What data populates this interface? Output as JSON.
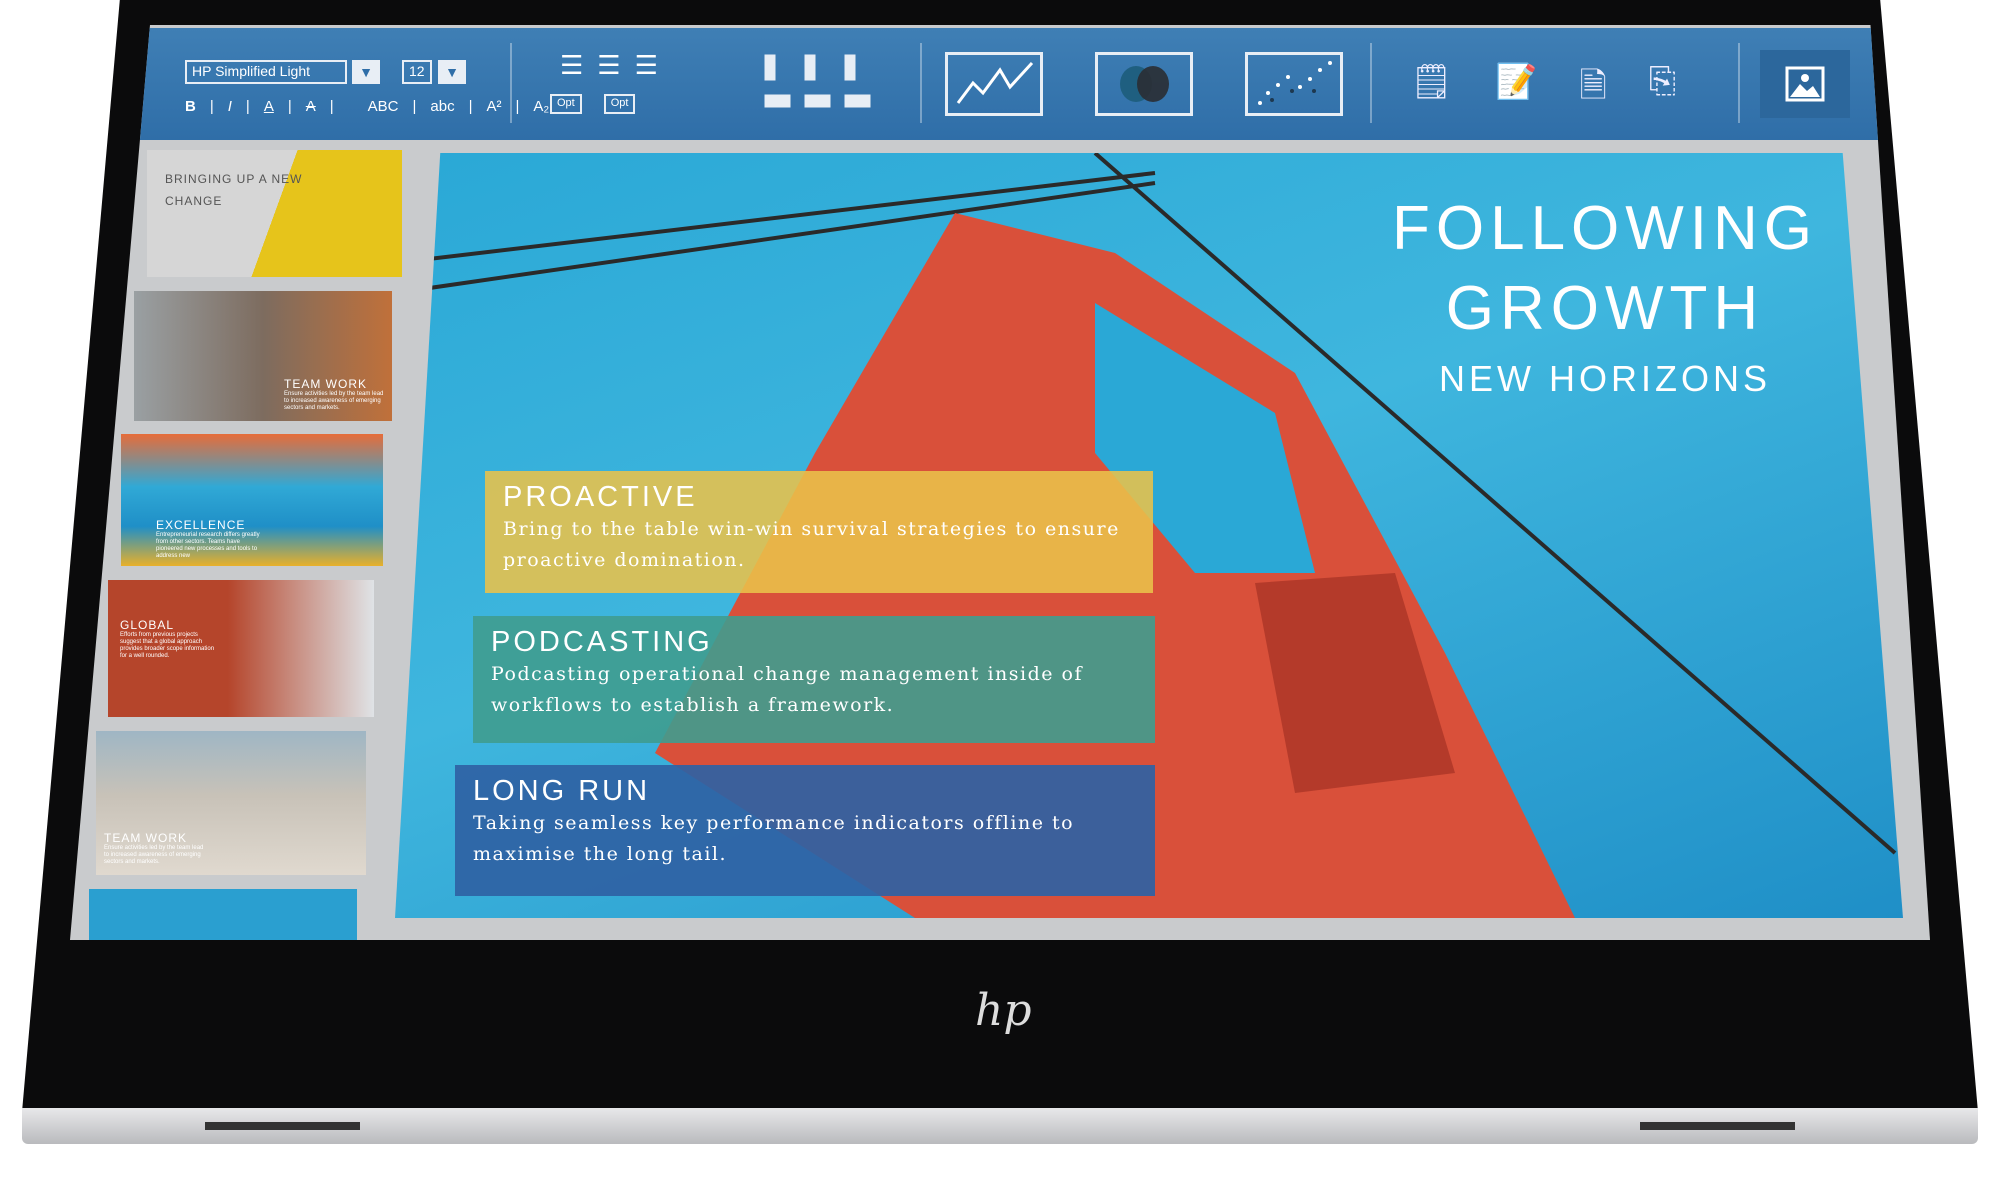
{
  "toolbar": {
    "font_name": "HP Simplified Light",
    "font_size": "12",
    "format_buttons": [
      "B",
      "I",
      "A",
      "A",
      "ABC",
      "abc",
      "A²",
      "A₂"
    ],
    "indent_opt_labels": [
      "Opt",
      "Opt"
    ],
    "chart_buttons": [
      "line-chart-icon",
      "venn-icon",
      "scatter-icon"
    ],
    "page_buttons": [
      "notepad-icon",
      "notepad-add-icon",
      "document-icon",
      "copy-icon"
    ],
    "image_button": "image-icon",
    "accent": "#2f6ea8"
  },
  "thumbnails": [
    {
      "title": "BRINGING UP A NEW CHANGE",
      "text": ""
    },
    {
      "title": "TEAM WORK",
      "text": "Ensure activities led by the team lead to increased awareness of emerging sectors and markets."
    },
    {
      "title": "EXCELLENCE",
      "text": "Entrepreneurial research differs greatly from other sectors. Teams have pioneered new processes and tools to address new"
    },
    {
      "title": "GLOBAL",
      "text": "Efforts from previous projects suggest that a global approach provides broader scope information for a well rounded."
    },
    {
      "title": "TEAM WORK",
      "text": "Ensure activities led by the team lead to increased awareness of emerging sectors and markets."
    },
    {
      "title": "",
      "text": ""
    }
  ],
  "slide": {
    "title_line1": "FOLLOWING",
    "title_line2": "GROWTH",
    "subtitle": "NEW HORIZONS",
    "bands": [
      {
        "heading": "PROACTIVE",
        "text": "Bring to the table win-win survival strategies to ensure proactive domination.",
        "color": "#e9c24a"
      },
      {
        "heading": "PODCASTING",
        "text": "Podcasting operational change management inside of workflows to establish a framework.",
        "color": "#3f9c8f"
      },
      {
        "heading": "LONG RUN",
        "text": "Taking seamless key performance indicators offline to maximise the long tail.",
        "color": "#2f62a4"
      }
    ]
  },
  "brand": "hp"
}
